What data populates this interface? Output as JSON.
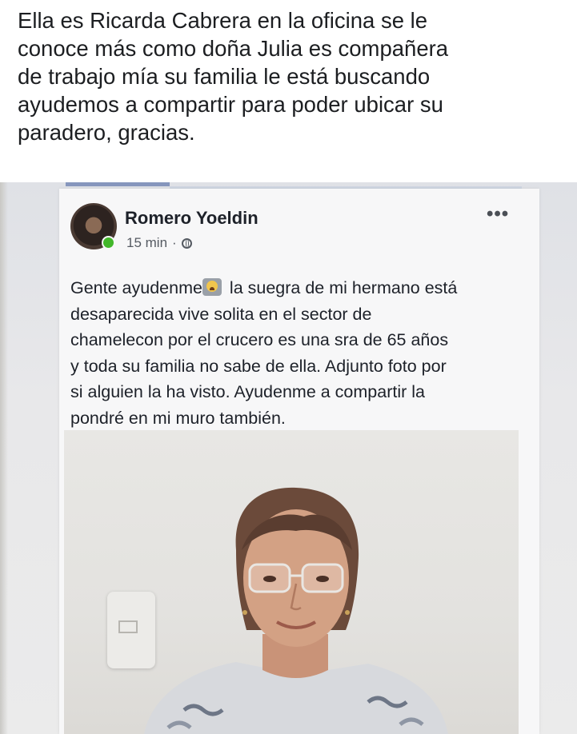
{
  "caption": {
    "lines": [
      "Ella es Ricarda Cabrera en la oficina se le",
      "conoce más como doña Julia es compañera",
      "de trabajo mía  su familia le está buscando",
      "ayudemos a compartir para poder ubicar su",
      "paradero, gracias."
    ]
  },
  "post": {
    "author": "Romero Yoeldin",
    "time": "15 min",
    "separator": "·",
    "privacy_icon": "globe-icon",
    "options_icon": "more-icon",
    "options_glyph": "•••",
    "text_lines": [
      {
        "before_emoji": "Gente ayudenme",
        "emoji": "crying-face",
        "after_emoji": " la suegra de mi hermano está"
      },
      {
        "text": "desaparecida vive solita en el sector de"
      },
      {
        "text": "chamelecon por el crucero es una sra de 65 años"
      },
      {
        "text": "y toda su familia no sabe de ella. Adjunto foto por"
      },
      {
        "text": "si alguien la ha visto. Ayudenme a compartir la"
      },
      {
        "text": "pondré en mi muro también."
      }
    ],
    "online_status_color": "#42b72a"
  }
}
